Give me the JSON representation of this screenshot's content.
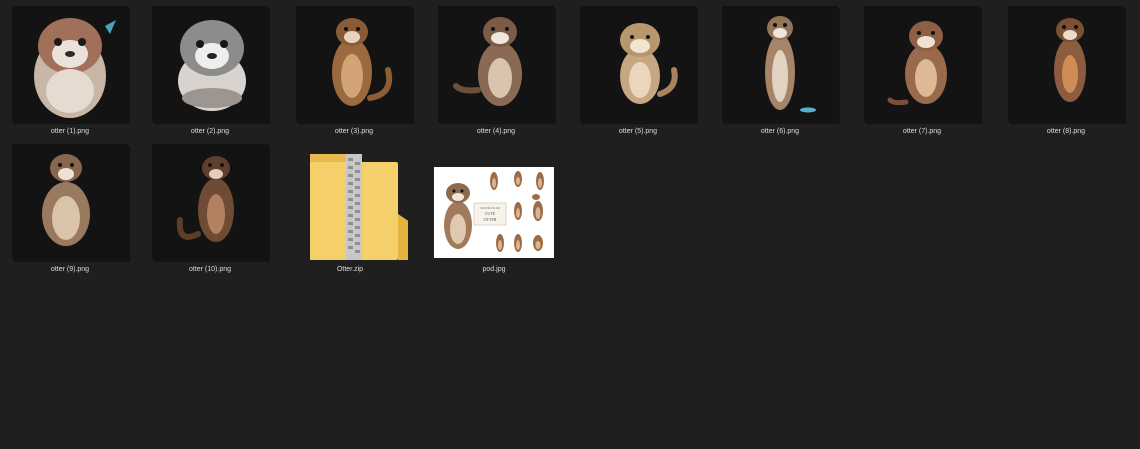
{
  "window": {
    "background": "#1f1f1f"
  },
  "files": [
    {
      "name": "otter (1).png",
      "type": "image",
      "fur": "#a0705a",
      "style": "fluffy"
    },
    {
      "name": "otter (2).png",
      "type": "image",
      "fur": "#8c8c8c",
      "style": "fluffy"
    },
    {
      "name": "otter (3).png",
      "type": "image",
      "fur": "#9b6a3f",
      "style": "standing"
    },
    {
      "name": "otter (4).png",
      "type": "image",
      "fur": "#8a6a55",
      "style": "standing"
    },
    {
      "name": "otter (5).png",
      "type": "image",
      "fur": "#b9976e",
      "style": "standing"
    },
    {
      "name": "otter (6).png",
      "type": "image",
      "fur": "#a58468",
      "style": "tall"
    },
    {
      "name": "otter (7).png",
      "type": "image",
      "fur": "#9a6a4c",
      "style": "standing"
    },
    {
      "name": "otter (8).png",
      "type": "image",
      "fur": "#8b5c3d",
      "style": "tall"
    },
    {
      "name": "otter (9).png",
      "type": "image",
      "fur": "#9a7a5e",
      "style": "standing"
    },
    {
      "name": "otter (10).png",
      "type": "image",
      "fur": "#6f4a35",
      "style": "standing"
    },
    {
      "name": "Otter.zip",
      "type": "zip-folder",
      "icon": "zip-folder-icon"
    },
    {
      "name": "pod.jpg",
      "type": "preview",
      "preview_text": [
        "WATERCOLOR",
        "CUTE",
        "OTTER"
      ]
    }
  ]
}
